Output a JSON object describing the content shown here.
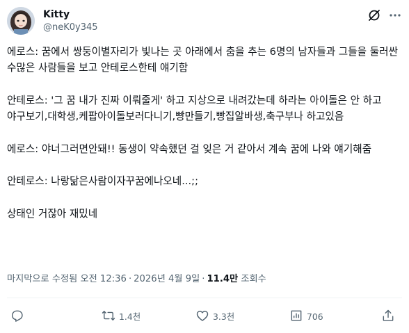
{
  "author": {
    "display_name": "Kitty",
    "handle": "@neK0y345"
  },
  "icons": {
    "grok": "grok-icon",
    "more": "more-icon",
    "reply": "reply-icon",
    "repost": "repost-icon",
    "like": "like-icon",
    "views": "views-icon",
    "bookmark": "bookmark-icon",
    "share": "share-icon"
  },
  "tweet": {
    "paragraphs": [
      "에로스: 꿈에서 쌍둥이별자리가 빛나는 곳 아래에서 춤을 추는 6명의 남자들과 그들을 둘러싼 수많은 사람들을 보고 안테로스한테 얘기함",
      "안테로스: '그 꿈 내가 진짜 이뤄줄게' 하고 지상으로 내려갔는데 하라는 아이돌은 안 하고 야구보기,대학생,케팝아이돌보러다니기,빵만들기,빵집알바생,축구부나 하고있음",
      "에로스: 야너그러면안돼!! 동생이 약속했던 걸 잊은 거 같아서 계속 꿈에 나와 얘기해줌",
      "안테로스: 나랑닮은사람이자꾸꿈에나오네...;;",
      "상태인 거잖아 재밌네"
    ]
  },
  "meta": {
    "edited": "마지막으로 수정됨",
    "time": "오전 12:36",
    "date": "2026년 4월 9일",
    "separator": "·",
    "views_count": "11.4만",
    "views_label": "조회수"
  },
  "actions": {
    "reply_count": "",
    "repost_count": "1.4천",
    "like_count": "3.3천",
    "views_count": "706"
  },
  "colors": {
    "text": "#0f1419",
    "secondary": "#536471",
    "divider": "#eff3f4"
  }
}
